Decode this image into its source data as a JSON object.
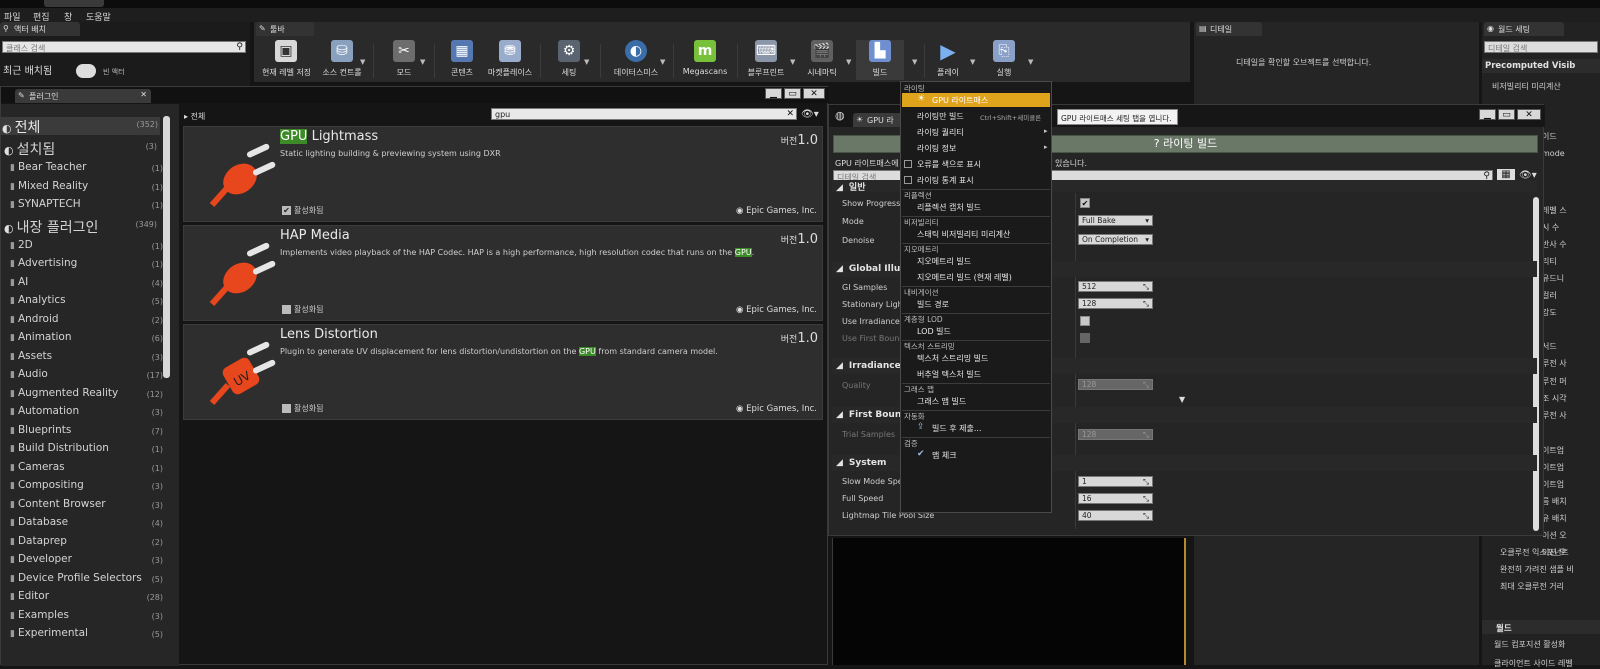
{
  "menubar": [
    "파일",
    "편집",
    "창",
    "도움말"
  ],
  "left_top": {
    "tab": "액터 배치",
    "search_placeholder": "클래스 검색",
    "recent": "최근 배치됨",
    "item": "빈 액터"
  },
  "toolbar": {
    "tab": "툴바",
    "buttons": [
      {
        "label": "현재 레벨 저장",
        "icon": "save-icon"
      },
      {
        "label": "소스 컨트롤",
        "icon": "source-control-icon"
      },
      {
        "label": "모드",
        "icon": "modes-icon"
      },
      {
        "label": "콘텐츠",
        "icon": "content-icon"
      },
      {
        "label": "마켓플레이스",
        "icon": "marketplace-icon"
      },
      {
        "label": "세팅",
        "icon": "settings-icon"
      },
      {
        "label": "데이터스미스",
        "icon": "datasmith-icon"
      },
      {
        "label": "Megascans",
        "icon": "megascans-icon"
      },
      {
        "label": "블루프린트",
        "icon": "blueprint-icon"
      },
      {
        "label": "시네마틱",
        "icon": "cinematics-icon"
      },
      {
        "label": "빌드",
        "icon": "build-icon"
      },
      {
        "label": "플레이",
        "icon": "play-icon"
      },
      {
        "label": "실행",
        "icon": "launch-icon"
      }
    ]
  },
  "details": {
    "tab": "디테일",
    "empty": "디테일을 확인할 오브젝트를 선택합니다."
  },
  "world_settings": {
    "tab": "월드 세팅",
    "search_placeholder": "디테일 검색",
    "section": "Precomputed Visib",
    "row": "비저빌리티 미리계산",
    "cut_rows": [
      "이드",
      "mode",
      "레벨 스",
      "시 수",
      "반사 수",
      "리티",
      "유드니",
      "컬러",
      "강도",
      "서드",
      "루전 사",
      "루전 머",
      "조 시각",
      "루전 사",
      "이트업",
      "이트업",
      "이트업",
      "름 배치",
      "유 배치",
      "이션 오",
      "이션 오"
    ],
    "ao_rows": [
      "오클루전 익스포넌트",
      "완전히 가려진 샘플 비",
      "최대 오클루전 거리"
    ],
    "world_section": "월드",
    "world_row1": "월드 컴포지션 활성화",
    "world_row2": "클라이언트 사이드 레벨"
  },
  "plugins": {
    "tab": "플러그인",
    "breadcrumb": "전체",
    "search_value": "gpu",
    "categories": [
      {
        "label": "전체",
        "count": "(352)",
        "kind": "head"
      },
      {
        "label": "설치됨",
        "count": "(3)",
        "kind": "big"
      },
      {
        "label": "Bear Teacher",
        "count": "(1)",
        "kind": "sub"
      },
      {
        "label": "Mixed Reality",
        "count": "(1)",
        "kind": "sub"
      },
      {
        "label": "SYNAPTECH",
        "count": "(1)",
        "kind": "sub"
      },
      {
        "label": "내장 플러그인",
        "count": "(349)",
        "kind": "big"
      },
      {
        "label": "2D",
        "count": "(1)",
        "kind": "sub"
      },
      {
        "label": "Advertising",
        "count": "(1)",
        "kind": "sub"
      },
      {
        "label": "AI",
        "count": "(4)",
        "kind": "sub"
      },
      {
        "label": "Analytics",
        "count": "(5)",
        "kind": "sub"
      },
      {
        "label": "Android",
        "count": "(2)",
        "kind": "sub"
      },
      {
        "label": "Animation",
        "count": "(6)",
        "kind": "sub"
      },
      {
        "label": "Assets",
        "count": "(3)",
        "kind": "sub"
      },
      {
        "label": "Audio",
        "count": "(17)",
        "kind": "sub"
      },
      {
        "label": "Augmented Reality",
        "count": "(12)",
        "kind": "sub"
      },
      {
        "label": "Automation",
        "count": "(3)",
        "kind": "sub"
      },
      {
        "label": "Blueprints",
        "count": "(7)",
        "kind": "sub"
      },
      {
        "label": "Build Distribution",
        "count": "(1)",
        "kind": "sub"
      },
      {
        "label": "Cameras",
        "count": "(1)",
        "kind": "sub"
      },
      {
        "label": "Compositing",
        "count": "(3)",
        "kind": "sub"
      },
      {
        "label": "Content Browser",
        "count": "(3)",
        "kind": "sub"
      },
      {
        "label": "Database",
        "count": "(4)",
        "kind": "sub"
      },
      {
        "label": "Dataprep",
        "count": "(2)",
        "kind": "sub"
      },
      {
        "label": "Developer",
        "count": "(3)",
        "kind": "sub"
      },
      {
        "label": "Device Profile Selectors",
        "count": "(5)",
        "kind": "sub"
      },
      {
        "label": "Editor",
        "count": "(28)",
        "kind": "sub"
      },
      {
        "label": "Examples",
        "count": "(3)",
        "kind": "sub"
      },
      {
        "label": "Experimental",
        "count": "(5)",
        "kind": "sub"
      }
    ],
    "cards": [
      {
        "title_hl": "GPU",
        "title_rest": " Lightmass",
        "desc_pre": "Static lighting building & previewing system using DXR",
        "desc_hl": "",
        "desc_post": "",
        "version_label": "버전",
        "version": "1.0",
        "enabled_label": "활성화됨",
        "enabled": true,
        "company": "Epic Games, Inc."
      },
      {
        "title_hl": "",
        "title_rest": "HAP Media",
        "desc_pre": "Implements video playback of the HAP Codec. HAP is a high performance, high resolution codec that runs on the ",
        "desc_hl": "GPU",
        "desc_post": ".",
        "version_label": "버전",
        "version": "1.0",
        "enabled_label": "활성화됨",
        "enabled": false,
        "company": "Epic Games, Inc."
      },
      {
        "title_hl": "",
        "title_rest": "Lens Distortion",
        "desc_pre": "Plugin to generate UV displacement for lens distortion/undistortion on the ",
        "desc_hl": "GPU",
        "desc_post": " from standard camera model.",
        "version_label": "버전",
        "version": "1.0",
        "enabled_label": "활성화됨",
        "enabled": false,
        "company": "Epic Games, Inc."
      }
    ]
  },
  "gpu_window": {
    "tab": "GPU 라",
    "build_button": "라이팅 빌드",
    "info_left": "GPU 라이트매스에",
    "info_right": "있습니다.",
    "search_placeholder": "디테일 검색",
    "section_general": "일반",
    "rows_general": [
      {
        "label": "Show Progress B",
        "type": "check",
        "checked": true
      },
      {
        "label": "Mode",
        "type": "combo",
        "value": "Full Bake"
      },
      {
        "label": "Denoise",
        "type": "combo",
        "value": "On Completion"
      }
    ],
    "section_gi": "Global Illumina",
    "rows_gi": [
      {
        "label": "GI Samples",
        "value": "512"
      },
      {
        "label": "Stationary Light",
        "value": "128"
      },
      {
        "label": "Use Irradiance C",
        "type": "check"
      },
      {
        "label": "Use First Bounc",
        "type": "check",
        "dim": true
      }
    ],
    "section_irr": "Irradiance Cac",
    "rows_irr": [
      {
        "label": "Quality",
        "value": "128",
        "dim": true
      }
    ],
    "section_fb": "First Bounce R",
    "rows_fb": [
      {
        "label": "Trial Samples",
        "value": "128",
        "dim": true
      }
    ],
    "section_sys": "System",
    "rows_sys": [
      {
        "label": "Slow Mode Spee",
        "value": "1"
      },
      {
        "label": "Full Speed",
        "value": "16"
      },
      {
        "label": "Lightmap Tile Pool Size",
        "value": "40"
      }
    ]
  },
  "build_menu": {
    "tooltip": "GPU 라이트매스 세팅 탭을 엽니다.",
    "items": [
      {
        "kind": "header",
        "text": "라이팅"
      },
      {
        "kind": "item",
        "text": "GPU 라이트매스",
        "highlight": true,
        "icon": "gpu-lightmass-icon"
      },
      {
        "kind": "item",
        "text": "라이팅만 빌드",
        "shortcut": "Ctrl+Shift+세미콜론"
      },
      {
        "kind": "item",
        "text": "라이팅 퀄리티",
        "submenu": true
      },
      {
        "kind": "item",
        "text": "라이팅 정보",
        "submenu": true
      },
      {
        "kind": "check",
        "text": "오류를 색으로 표시"
      },
      {
        "kind": "check",
        "text": "라이팅 통계 표시"
      },
      {
        "kind": "header",
        "text": "리플렉션"
      },
      {
        "kind": "item",
        "text": "리플렉션 캡처 빌드"
      },
      {
        "kind": "header",
        "text": "비저빌리티"
      },
      {
        "kind": "item",
        "text": "스태틱 비저빌리티 미리계산"
      },
      {
        "kind": "header",
        "text": "지오메트리"
      },
      {
        "kind": "item",
        "text": "지오메트리 빌드"
      },
      {
        "kind": "item",
        "text": "지오메트리 빌드 (현재 레벨)"
      },
      {
        "kind": "header",
        "text": "내비게이션"
      },
      {
        "kind": "item",
        "text": "빌드 경로"
      },
      {
        "kind": "header",
        "text": "계층형 LOD"
      },
      {
        "kind": "item",
        "text": "LOD 빌드"
      },
      {
        "kind": "header",
        "text": "텍스처 스트리밍"
      },
      {
        "kind": "item",
        "text": "텍스처 스트리밍 빌드"
      },
      {
        "kind": "item",
        "text": "버추얼 텍스처 빌드"
      },
      {
        "kind": "header",
        "text": "그래스 맵"
      },
      {
        "kind": "item",
        "text": "그래스 맵 빌드"
      },
      {
        "kind": "header",
        "text": "자동화"
      },
      {
        "kind": "item",
        "text": "빌드 후 제출...",
        "icon": "submit-icon"
      },
      {
        "kind": "header",
        "text": "검증"
      },
      {
        "kind": "item",
        "text": "맵 체크",
        "icon": "map-check-icon"
      }
    ]
  },
  "colors": {
    "menu_highlight": "#e0a31c",
    "search_highlight": "#3c8a28",
    "plug_orange": "#e8461c"
  }
}
